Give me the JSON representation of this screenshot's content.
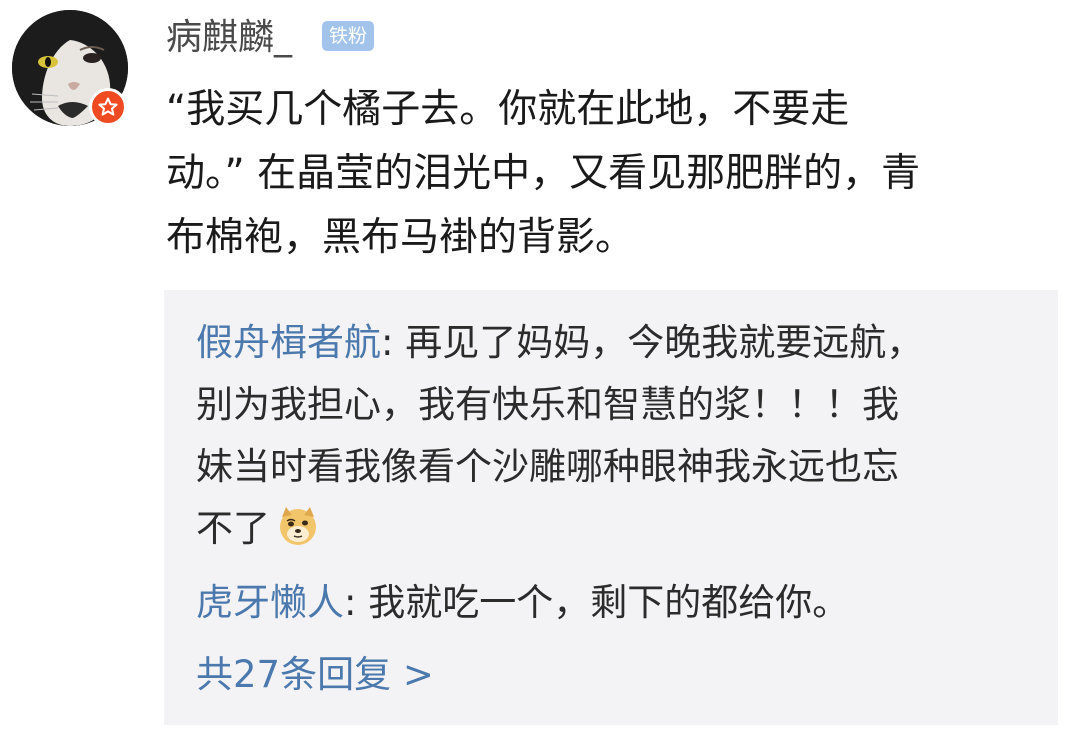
{
  "post": {
    "username": "病麒麟_",
    "fan_badge": "铁粉",
    "text_lines": [
      "“我买几个橘子去。你就在此地，不要走",
      "动。” 在晶莹的泪光中，又看见那肥胖的，青",
      "布棉袍，黑布马褂的背影。"
    ]
  },
  "replies": [
    {
      "author": "假舟楫者航",
      "separator": ": ",
      "lines": [
        "再见了妈妈，今晚我就要远航，",
        "别为我担心，我有快乐和智慧的浆！！！我",
        "妹当时看我像看个沙雕哪种眼神我永远也忘",
        "不了"
      ],
      "emoji": "doge-emoji"
    },
    {
      "author": "虎牙懒人",
      "separator": ": ",
      "text": "我就吃一个，剩下的都给你。"
    }
  ],
  "more_replies": "共27条回复 >",
  "colors": {
    "link_blue": "#4b79ad",
    "badge_blue": "#a3c4ea",
    "vip_red": "#f04a23",
    "reply_bg": "#f3f3f5"
  },
  "icons": {
    "avatar": "cat-avatar",
    "vip": "vip-star-icon"
  }
}
